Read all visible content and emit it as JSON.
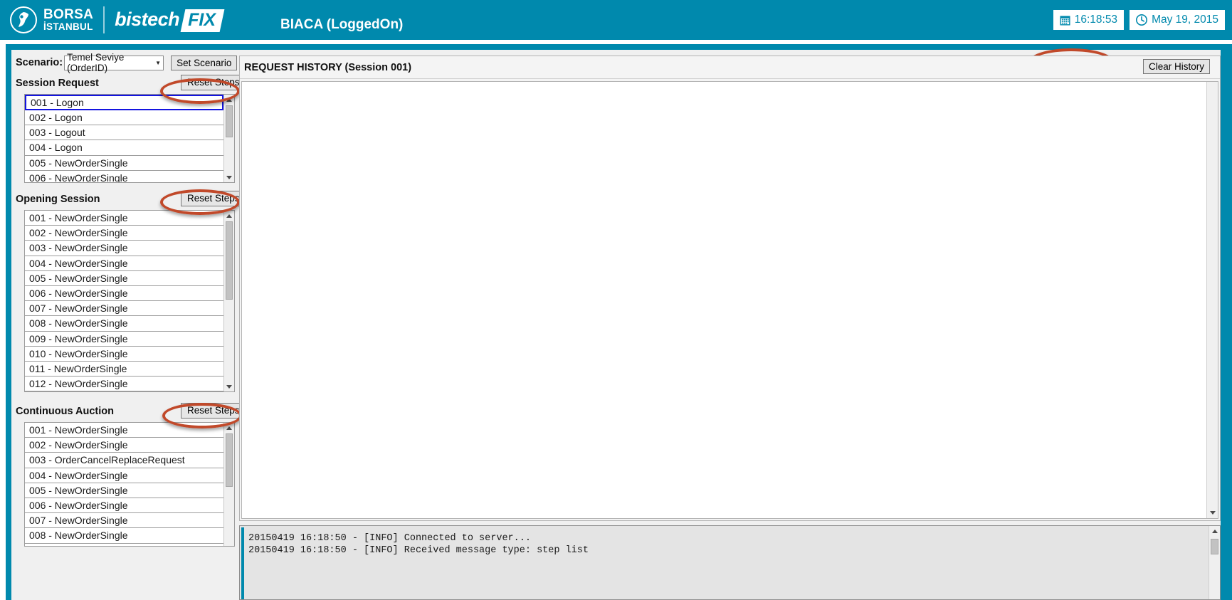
{
  "header": {
    "brand_primary": "BORSA",
    "brand_secondary": "İSTANBUL",
    "product_name": "bistech",
    "product_badge": "FIX",
    "session_title": "BIACA (LoggedOn)",
    "time_value": "16:18:53",
    "time_icon": "calendar-icon",
    "date_value": "May 19, 2015",
    "date_icon": "clock-icon",
    "background_color": "#0089ad"
  },
  "scenario": {
    "label": "Scenario:",
    "selected": "Temel Seviye (OrderID)",
    "options": [
      "Temel Seviye (OrderID)"
    ],
    "set_button": "Set Scenario"
  },
  "sections": [
    {
      "title": "Session Request",
      "reset_label": "Reset Steps",
      "items": [
        "001 - Logon",
        "002 - Logon",
        "003 - Logout",
        "004 - Logon",
        "005 - NewOrderSingle",
        "006 - NewOrderSingle"
      ],
      "selected_index": 0
    },
    {
      "title": "Opening Session",
      "reset_label": "Reset Steps",
      "items": [
        "001 - NewOrderSingle",
        "002 - NewOrderSingle",
        "003 - NewOrderSingle",
        "004 - NewOrderSingle",
        "005 - NewOrderSingle",
        "006 - NewOrderSingle",
        "007 - NewOrderSingle",
        "008 - NewOrderSingle",
        "009 - NewOrderSingle",
        "010 - NewOrderSingle",
        "011 - NewOrderSingle",
        "012 - NewOrderSingle"
      ],
      "selected_index": -1
    },
    {
      "title": "Continuous Auction",
      "reset_label": "Reset Steps",
      "items": [
        "001 - NewOrderSingle",
        "002 - NewOrderSingle",
        "003 - OrderCancelReplaceRequest",
        "004 - NewOrderSingle",
        "005 - NewOrderSingle",
        "006 - NewOrderSingle",
        "007 - NewOrderSingle",
        "008 - NewOrderSingle"
      ],
      "selected_index": -1
    }
  ],
  "history": {
    "title": "REQUEST HISTORY (Session 001)",
    "clear_button": "Clear History",
    "entries": []
  },
  "log": {
    "lines": [
      "20150419 16:18:50 - [INFO] Connected to server...",
      "20150419 16:18:50 - [INFO] Received message type: step list"
    ]
  },
  "annotations": {
    "color": "#c1492a",
    "targets": [
      "reset-steps-session-request",
      "reset-steps-opening-session",
      "reset-steps-continuous-auction",
      "clear-history-button"
    ]
  }
}
